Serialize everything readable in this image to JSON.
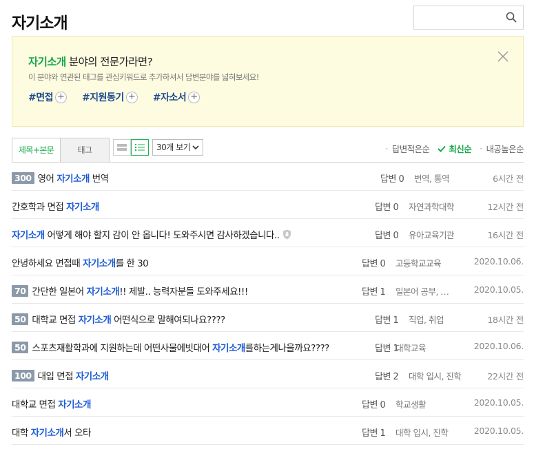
{
  "page_title": "자기소개",
  "search": {
    "value": "",
    "icon": "search-icon"
  },
  "banner": {
    "headline_highlight": "자기소개",
    "headline_rest": " 분야의 전문가라면?",
    "description": "이 분야와 연관된 태그를 관심키워드로 추가하셔서 답변분야를 넓혀보세요!",
    "tags": [
      "#면접",
      "#지원동기",
      "#자소서"
    ],
    "plus_symbol": "+"
  },
  "tabs": {
    "active": "제목+본문",
    "inactive": "태그"
  },
  "per_page": "30개 보기",
  "sorts": [
    {
      "label": "답변적은순",
      "active": false
    },
    {
      "label": "최신순",
      "active": true
    },
    {
      "label": "내공높은순",
      "active": false
    }
  ],
  "colors": {
    "accent_green": "#16a84a",
    "keyword_blue": "#1d5bd6",
    "badge_gray": "#8c99a8",
    "banner_bg": "#fdfbe0"
  },
  "questions": [
    {
      "badge": "300",
      "parts": [
        [
          "영어 ",
          false
        ],
        [
          "자기소개",
          true
        ],
        [
          " 번역",
          false
        ]
      ],
      "answers": "답변 0",
      "category": "번역, 통역",
      "time": "6시간 전",
      "lock": false
    },
    {
      "badge": "",
      "parts": [
        [
          "간호학과 면접 ",
          false
        ],
        [
          "자기소개",
          true
        ]
      ],
      "answers": "답변 0",
      "category": "자연과학대학",
      "time": "12시간 전",
      "lock": false
    },
    {
      "badge": "",
      "parts": [
        [
          "자기소개",
          true
        ],
        [
          " 어떻게 해야 할지 감이 안 옵니다! 도와주시면 감사하겠습니다..",
          false
        ]
      ],
      "answers": "답변 0",
      "category": "유아교육기관",
      "time": "16시간 전",
      "lock": true
    },
    {
      "badge": "",
      "parts": [
        [
          "안녕하세요 면접때 ",
          false
        ],
        [
          "자기소개",
          true
        ],
        [
          "를 한 30",
          false
        ]
      ],
      "answers": "답변 0",
      "category": "고등학교교육",
      "time": "2020.10.06.",
      "lock": false
    },
    {
      "badge": "70",
      "parts": [
        [
          "간단한 일본어 ",
          false
        ],
        [
          "자기소개",
          true
        ],
        [
          "!! 제발.. 능력자분들 도와주세요!!!",
          false
        ]
      ],
      "answers": "답변 1",
      "category": "일본어 공부, …",
      "time": "2020.10.05.",
      "lock": false
    },
    {
      "badge": "50",
      "parts": [
        [
          "대학교 면접 ",
          false
        ],
        [
          "자기소개",
          true
        ],
        [
          " 어떤식으로 말해여되나요????",
          false
        ]
      ],
      "answers": "답변 1",
      "category": "직업, 취업",
      "time": "18시간 전",
      "lock": false
    },
    {
      "badge": "50",
      "parts": [
        [
          "스포츠재활학과에 지원하는데 어떤사물에빗대어 ",
          false
        ],
        [
          "자기소개",
          true
        ],
        [
          "를하는게나을까요????",
          false
        ]
      ],
      "answers": "답변 1",
      "category": "대학교육",
      "time": "2020.10.06.",
      "lock": false
    },
    {
      "badge": "100",
      "parts": [
        [
          "대입 면접 ",
          false
        ],
        [
          "자기소개",
          true
        ]
      ],
      "answers": "답변 2",
      "category": "대학 입시, 진학",
      "time": "22시간 전",
      "lock": false
    },
    {
      "badge": "",
      "parts": [
        [
          "대학교 면접 ",
          false
        ],
        [
          "자기소개",
          true
        ]
      ],
      "answers": "답변 0",
      "category": "학교생활",
      "time": "2020.10.05.",
      "lock": false
    },
    {
      "badge": "",
      "parts": [
        [
          "대학 ",
          false
        ],
        [
          "자기소개",
          true
        ],
        [
          "서 오타",
          false
        ]
      ],
      "answers": "답변 1",
      "category": "대학 입시, 진학",
      "time": "2020.10.05.",
      "lock": false
    }
  ]
}
